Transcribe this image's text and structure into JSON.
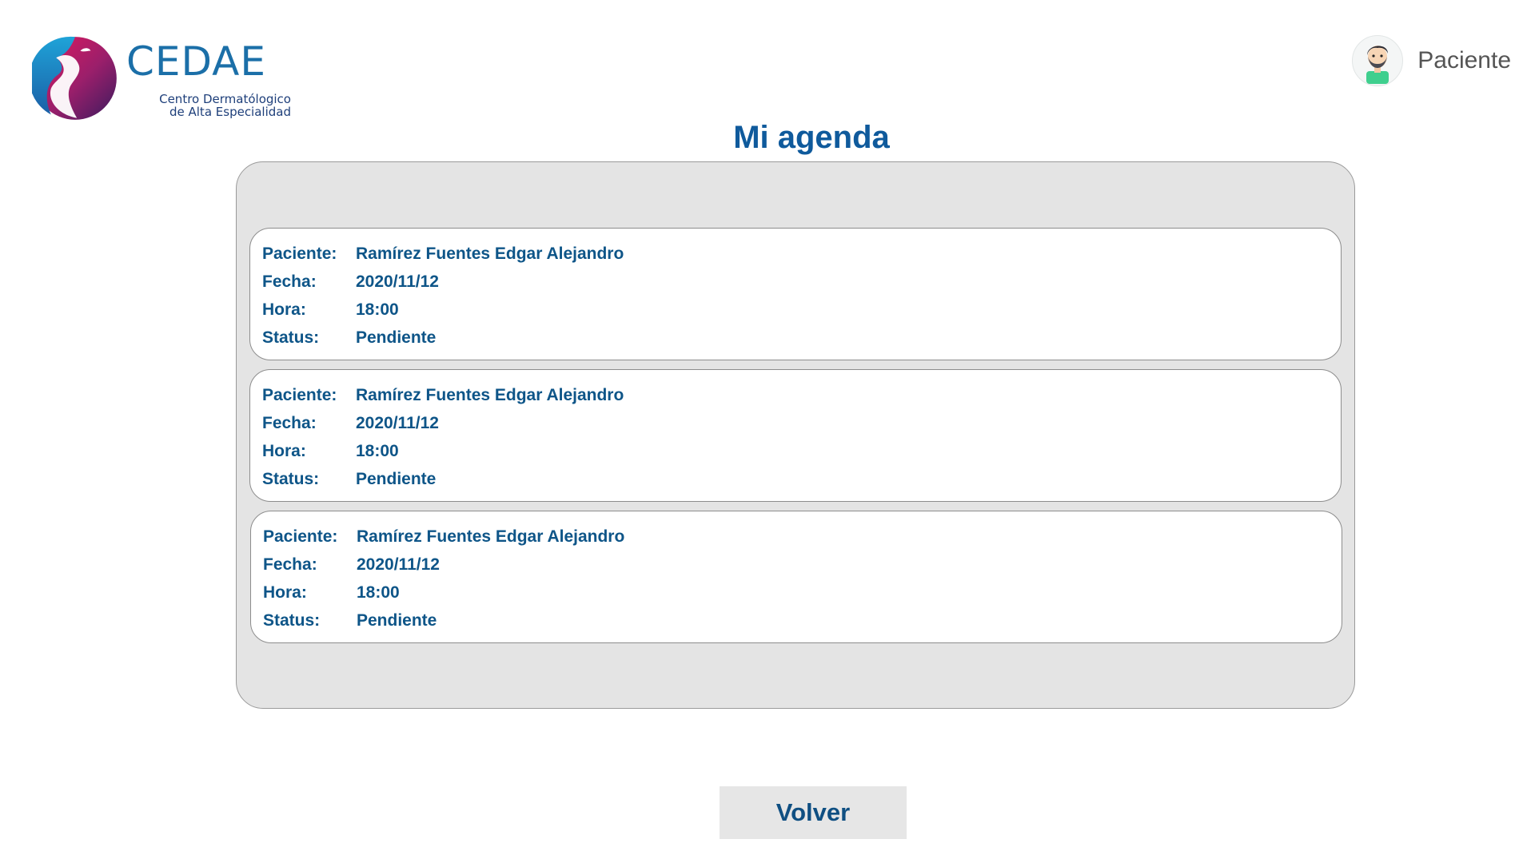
{
  "logo": {
    "title": "CEDAE",
    "subtitle_line1": "Centro Dermatólogico",
    "subtitle_line2": "de Alta Especialidad"
  },
  "user": {
    "label": "Paciente",
    "avatar_icon": "user-avatar-icon"
  },
  "page_title": "Mi agenda",
  "field_labels": {
    "patient": "Paciente:",
    "date": "Fecha:",
    "time": "Hora:",
    "status": "Status:"
  },
  "appointments": [
    {
      "patient": "Ramírez Fuentes Edgar Alejandro",
      "date": "2020/11/12",
      "time": "18:00",
      "status": "Pendiente"
    },
    {
      "patient": "Ramírez Fuentes Edgar Alejandro",
      "date": "2020/11/12",
      "time": "18:00",
      "status": "Pendiente"
    },
    {
      "patient": "Ramírez Fuentes Edgar Alejandro",
      "date": "2020/11/12",
      "time": "18:00",
      "status": "Pendiente"
    }
  ],
  "back_button_label": "Volver",
  "colors": {
    "brand_blue": "#0f5a9c",
    "brand_magenta": "#d81b60",
    "panel_gray": "#e4e4e4"
  }
}
